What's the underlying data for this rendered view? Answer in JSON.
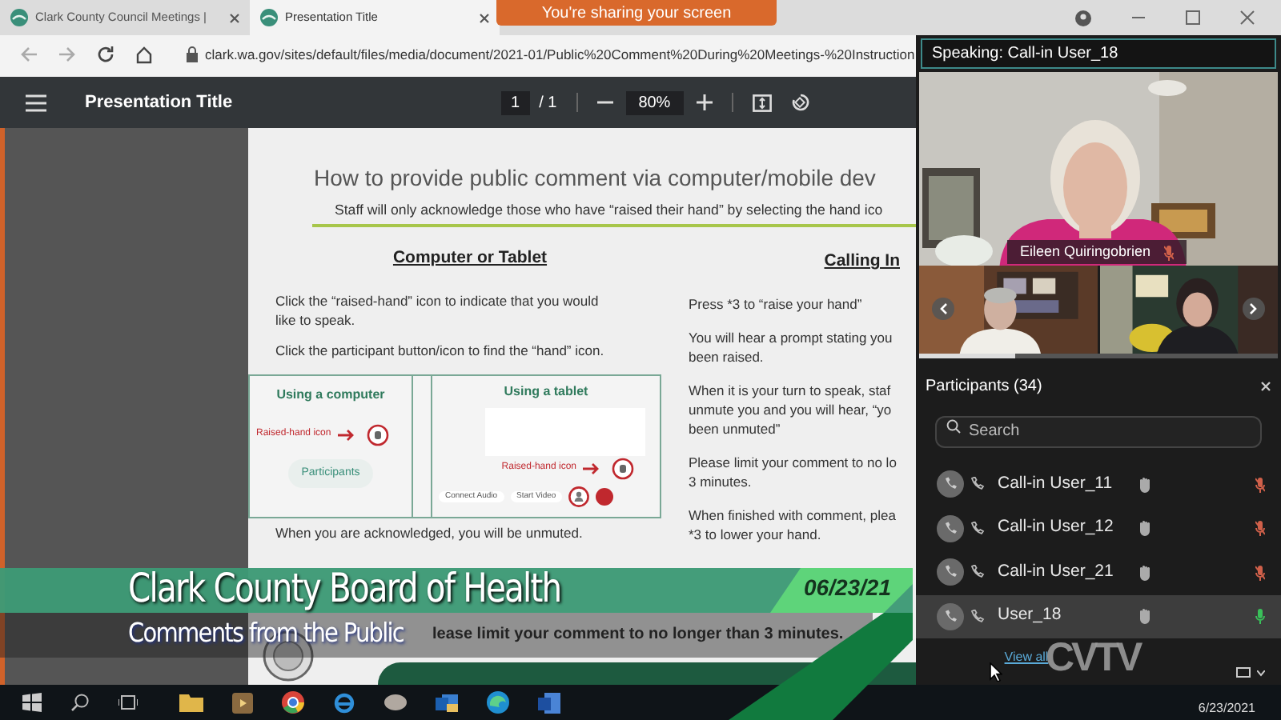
{
  "browser": {
    "tabs": [
      {
        "title": "Clark County Council Meetings |",
        "selected": false
      },
      {
        "title": "Presentation Title",
        "selected": true
      }
    ],
    "address": "clark.wa.gov/sites/default/files/media/document/2021-01/Public%20Comment%20During%20Meetings-%20Instruction"
  },
  "sharing_banner": "You're sharing your screen",
  "pdf_toolbar": {
    "title": "Presentation Title",
    "page": "1",
    "page_total": "/ 1",
    "zoom": "80%"
  },
  "document": {
    "heading": "How to provide public comment via computer/mobile dev",
    "subheading": "Staff will only acknowledge those who have “raised their hand” by selecting the hand ico",
    "left": {
      "heading": "Computer or Tablet",
      "paragraphs": [
        [
          "Click the “raised-hand” icon to indicate that you would",
          "like to speak."
        ],
        [
          "Click the participant button/icon to find the “hand” icon."
        ]
      ],
      "figure": {
        "computer_label": "Using a computer",
        "computer_callout": "Raised-hand icon",
        "participants_button": "Participants",
        "tablet_label": "Using a tablet",
        "tablet_callout": "Raised-hand icon",
        "audio_button": "Connect Audio",
        "video_button": "Start Video"
      },
      "after": "When you are acknowledged, you will be unmuted."
    },
    "right": {
      "heading": "Calling In",
      "paragraphs": [
        [
          "Press *3 to “raise your hand”"
        ],
        [
          "You will hear a prompt stating you",
          "been raised."
        ],
        [
          "When it is your turn to speak, staf",
          "unmute you and you will hear, “yo",
          "been unmuted”"
        ],
        [
          "Please limit your comment to no lo",
          "3 minutes."
        ],
        [
          "When finished with comment, plea",
          "*3 to lower your hand."
        ]
      ]
    },
    "footer_note": "lease limit your comment to no longer than 3 minutes."
  },
  "meeting": {
    "speaking": "Speaking: Call-in User_18",
    "main_video_name": "Eileen Quiringobrien",
    "participants_title": "Participants (34)",
    "search": {
      "placeholder": "Search"
    },
    "participants": [
      {
        "name": "Call-in User_11",
        "muted": true,
        "selected": false
      },
      {
        "name": "Call-in User_12",
        "muted": true,
        "selected": false
      },
      {
        "name": "Call-in User_21",
        "muted": true,
        "selected": false
      },
      {
        "name": "User_18",
        "muted": false,
        "selected": true
      }
    ],
    "view_all": "View all"
  },
  "lower_third": {
    "title": "Clark County Board of Health",
    "subtitle": "Comments from the Public",
    "date": "06/23/21",
    "logo": "CVTV"
  },
  "taskbar": {
    "date": "6/23/2021"
  }
}
